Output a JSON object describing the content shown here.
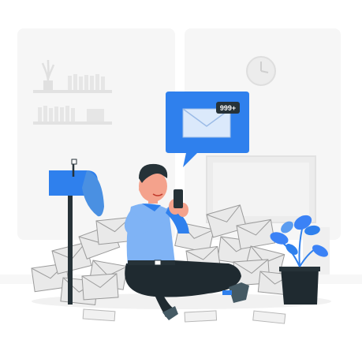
{
  "notification": {
    "count_badge": "999+"
  },
  "colors": {
    "accent": "#2f80ed",
    "accent_light": "#7fb3f5",
    "envelope_fill": "#e9e9e9",
    "envelope_stroke": "#9b9b9b",
    "furniture": "#f4f4f4",
    "dark": "#263238",
    "skin": "#f4a28c",
    "pants": "#1f2a30",
    "plant_leaf": "#3b82f6"
  },
  "icons": {
    "envelope": "envelope-icon",
    "mailbox": "mailbox-icon",
    "clock": "clock-icon",
    "plant": "potted-plant-icon",
    "phone": "smartphone-icon"
  }
}
